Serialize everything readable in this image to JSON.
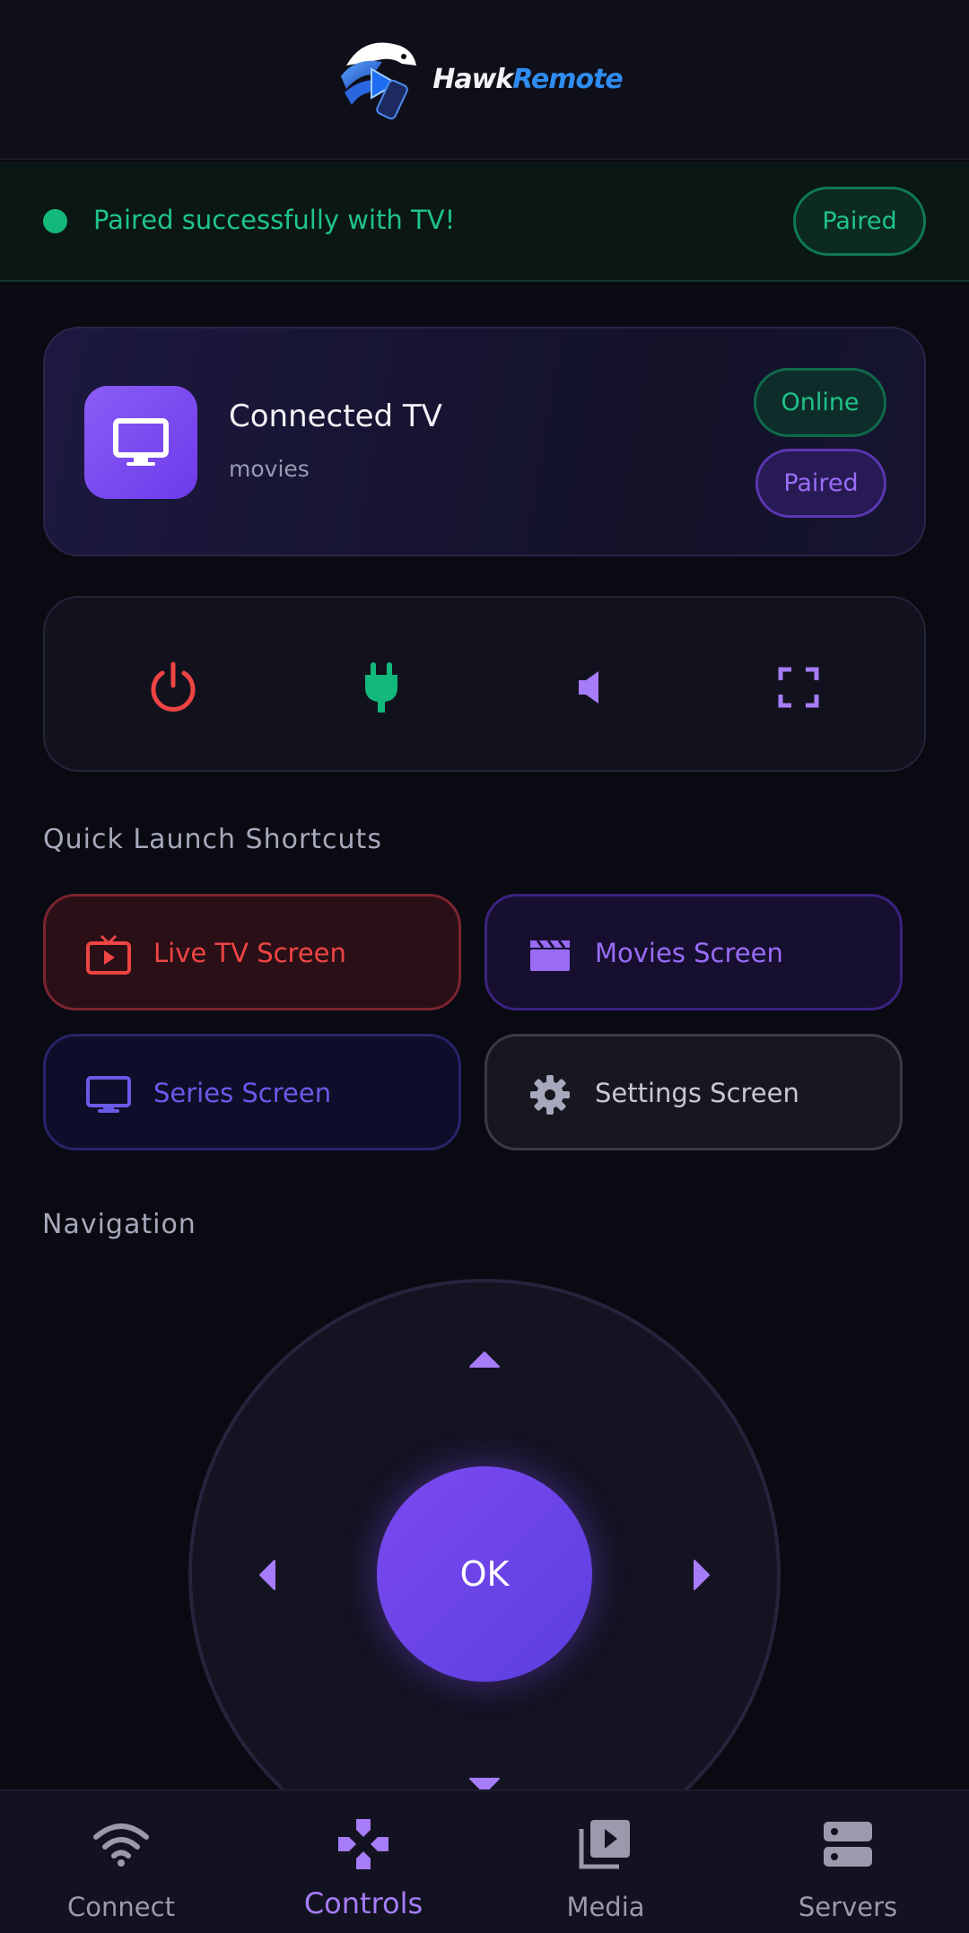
{
  "app": {
    "logo_word1": "Hawk",
    "logo_word2": "Remote"
  },
  "banner": {
    "message": "Paired successfully with TV!",
    "badge": "Paired"
  },
  "tv_card": {
    "title": "Connected TV",
    "subtitle": "movies",
    "status_online": "Online",
    "status_paired": "Paired"
  },
  "controls": {
    "icons": [
      "power-icon",
      "plug-icon",
      "volume-icon",
      "fullscreen-icon"
    ]
  },
  "shortcuts": {
    "title": "Quick Launch Shortcuts",
    "items": [
      {
        "label": "Live TV Screen",
        "icon": "live-tv-icon",
        "color": "#ef4444"
      },
      {
        "label": "Movies Screen",
        "icon": "clapperboard-icon",
        "color": "#9a6cf6"
      },
      {
        "label": "Series Screen",
        "icon": "monitor-icon",
        "color": "#6a5ae8"
      },
      {
        "label": "Settings Screen",
        "icon": "gear-icon",
        "color": "#c8c8d4"
      }
    ]
  },
  "navigation": {
    "title": "Navigation",
    "ok_label": "OK"
  },
  "bottom_nav": {
    "items": [
      {
        "label": "Connect",
        "icon": "wifi-icon",
        "active": false
      },
      {
        "label": "Controls",
        "icon": "gamepad-icon",
        "active": true
      },
      {
        "label": "Media",
        "icon": "media-library-icon",
        "active": false
      },
      {
        "label": "Servers",
        "icon": "server-icon",
        "active": false
      }
    ]
  },
  "colors": {
    "accent": "#8b5cf6",
    "success": "#1fc488",
    "danger": "#ef4444",
    "background": "#0a0a12"
  }
}
